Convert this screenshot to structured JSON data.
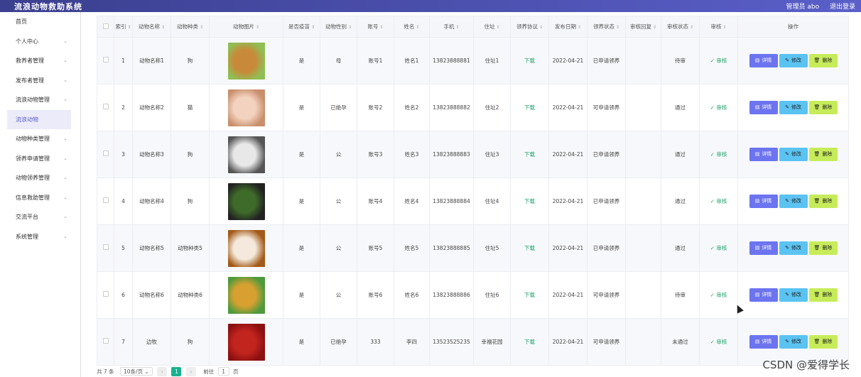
{
  "header": {
    "title": "流浪动物救助系统",
    "admin": "管理员 abo",
    "logout": "退出登录"
  },
  "sidebar": {
    "items": [
      {
        "label": "首页",
        "chev": false,
        "active": false
      },
      {
        "label": "个人中心",
        "chev": true,
        "active": false
      },
      {
        "label": "救养者管理",
        "chev": true,
        "active": false
      },
      {
        "label": "发布者管理",
        "chev": true,
        "active": false
      },
      {
        "label": "流浪动物管理",
        "chev": true,
        "active": false
      },
      {
        "label": "流浪动物",
        "chev": false,
        "active": true
      },
      {
        "label": "动物种类管理",
        "chev": true,
        "active": false
      },
      {
        "label": "领养申请管理",
        "chev": true,
        "active": false
      },
      {
        "label": "动物领养管理",
        "chev": true,
        "active": false
      },
      {
        "label": "信息救助管理",
        "chev": true,
        "active": false
      },
      {
        "label": "交流平台",
        "chev": true,
        "active": false
      },
      {
        "label": "系统管理",
        "chev": true,
        "active": false
      }
    ]
  },
  "table": {
    "headers": [
      "索引",
      "动物名称",
      "动物种类",
      "动物图片",
      "是否疫苗",
      "动物性别",
      "账号",
      "姓名",
      "手机",
      "住址",
      "领养协议",
      "发布日期",
      "领养状态",
      "审核回复",
      "审核状态",
      "审核",
      "操作"
    ],
    "rows": [
      {
        "idx": "1",
        "name": "动物名称1",
        "kind": "狗",
        "vacc": "是",
        "sex": "母",
        "acct": "账号1",
        "person": "姓名1",
        "phone": "13823888881",
        "addr": "住址1",
        "agree": "下载",
        "date": "2022-04-21",
        "status": "已申请领养",
        "reply": "",
        "audit": "待审",
        "auditbtn": "审核",
        "photo": [
          "#c88a3a",
          "#8fbf54"
        ]
      },
      {
        "idx": "2",
        "name": "动物名称2",
        "kind": "猫",
        "vacc": "是",
        "sex": "已绝孕",
        "acct": "账号2",
        "person": "姓名2",
        "phone": "13823888882",
        "addr": "住址2",
        "agree": "下载",
        "date": "2022-04-21",
        "status": "可申请领养",
        "reply": "",
        "audit": "通过",
        "auditbtn": "审核",
        "photo": [
          "#f3d2c0",
          "#c98f6c"
        ]
      },
      {
        "idx": "3",
        "name": "动物名称3",
        "kind": "狗",
        "vacc": "是",
        "sex": "公",
        "acct": "账号3",
        "person": "姓名3",
        "phone": "13823888883",
        "addr": "住址3",
        "agree": "下载",
        "date": "2022-04-21",
        "status": "已申请领养",
        "reply": "",
        "audit": "通过",
        "auditbtn": "审核",
        "photo": [
          "#e8e8e8",
          "#555555"
        ]
      },
      {
        "idx": "4",
        "name": "动物名称4",
        "kind": "狗",
        "vacc": "是",
        "sex": "公",
        "acct": "账号4",
        "person": "姓名4",
        "phone": "13823888884",
        "addr": "住址4",
        "agree": "下载",
        "date": "2022-04-21",
        "status": "已申请领养",
        "reply": "",
        "audit": "通过",
        "auditbtn": "审核",
        "photo": [
          "#3f6b2a",
          "#222222"
        ]
      },
      {
        "idx": "5",
        "name": "动物名称5",
        "kind": "动物种类5",
        "vacc": "是",
        "sex": "公",
        "acct": "账号5",
        "person": "姓名5",
        "phone": "13823888885",
        "addr": "住址5",
        "agree": "下载",
        "date": "2022-04-21",
        "status": "已申请领养",
        "reply": "",
        "audit": "通过",
        "auditbtn": "审核",
        "photo": [
          "#f4e9dc",
          "#a35a18"
        ]
      },
      {
        "idx": "6",
        "name": "动物名称6",
        "kind": "动物种类6",
        "vacc": "是",
        "sex": "公",
        "acct": "账号6",
        "person": "姓名6",
        "phone": "13823888886",
        "addr": "住址6",
        "agree": "下载",
        "date": "2022-04-21",
        "status": "可申请领养",
        "reply": "",
        "audit": "待审",
        "auditbtn": "审核",
        "photo": [
          "#d8a030",
          "#4e9a3c"
        ]
      },
      {
        "idx": "7",
        "name": "边牧",
        "kind": "狗",
        "vacc": "是",
        "sex": "已绝孕",
        "acct": "333",
        "person": "李四",
        "phone": "13523525235",
        "addr": "幸福花园",
        "agree": "下载",
        "date": "2022-04-21",
        "status": "可申请领养",
        "reply": "",
        "audit": "未通过",
        "auditbtn": "审核",
        "photo": [
          "#c2241e",
          "#8b1010"
        ]
      }
    ],
    "buttons": {
      "detail": "详情",
      "edit": "修改",
      "delete": "删除"
    }
  },
  "pager": {
    "total": "共 7 条",
    "size": "10条/页",
    "page": "1",
    "goto": "前往",
    "jumpval": "1",
    "unit": "页"
  },
  "watermark": "CSDN @爱得学长"
}
